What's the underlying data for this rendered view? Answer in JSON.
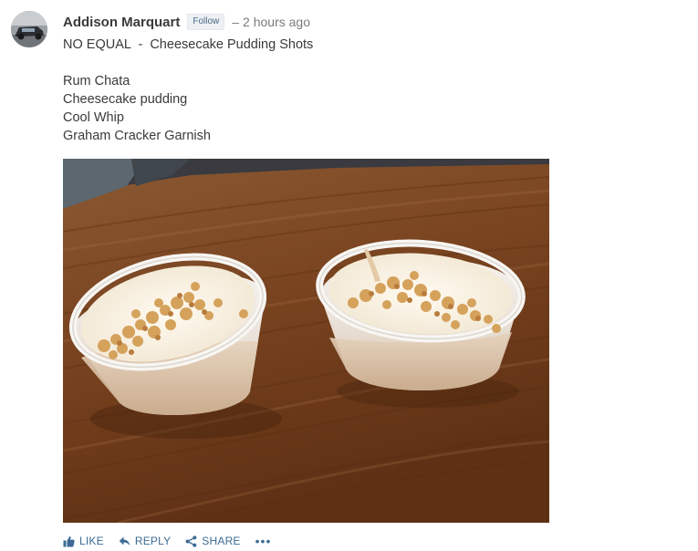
{
  "post": {
    "author": "Addison Marquart",
    "follow_label": "Follow",
    "separator": "–",
    "time": "2 hours ago",
    "body_lines": [
      "NO EQUAL  -  Cheesecake Pudding Shots",
      "",
      "Rum Chata",
      "Cheesecake pudding",
      "Cool Whip",
      "Graham Cracker Garnish"
    ]
  },
  "actions": {
    "like_label": "LIKE",
    "reply_label": "REPLY",
    "share_label": "SHARE",
    "more_label": "•••"
  },
  "icons": {
    "like": "thumbs-up-icon",
    "reply": "reply-arrow-icon",
    "share": "share-icon",
    "more": "more-dots-icon"
  },
  "colors": {
    "action_blue": "#3d6b95",
    "author_text": "#3a3a3a",
    "meta_gray": "#7b7b7b"
  }
}
